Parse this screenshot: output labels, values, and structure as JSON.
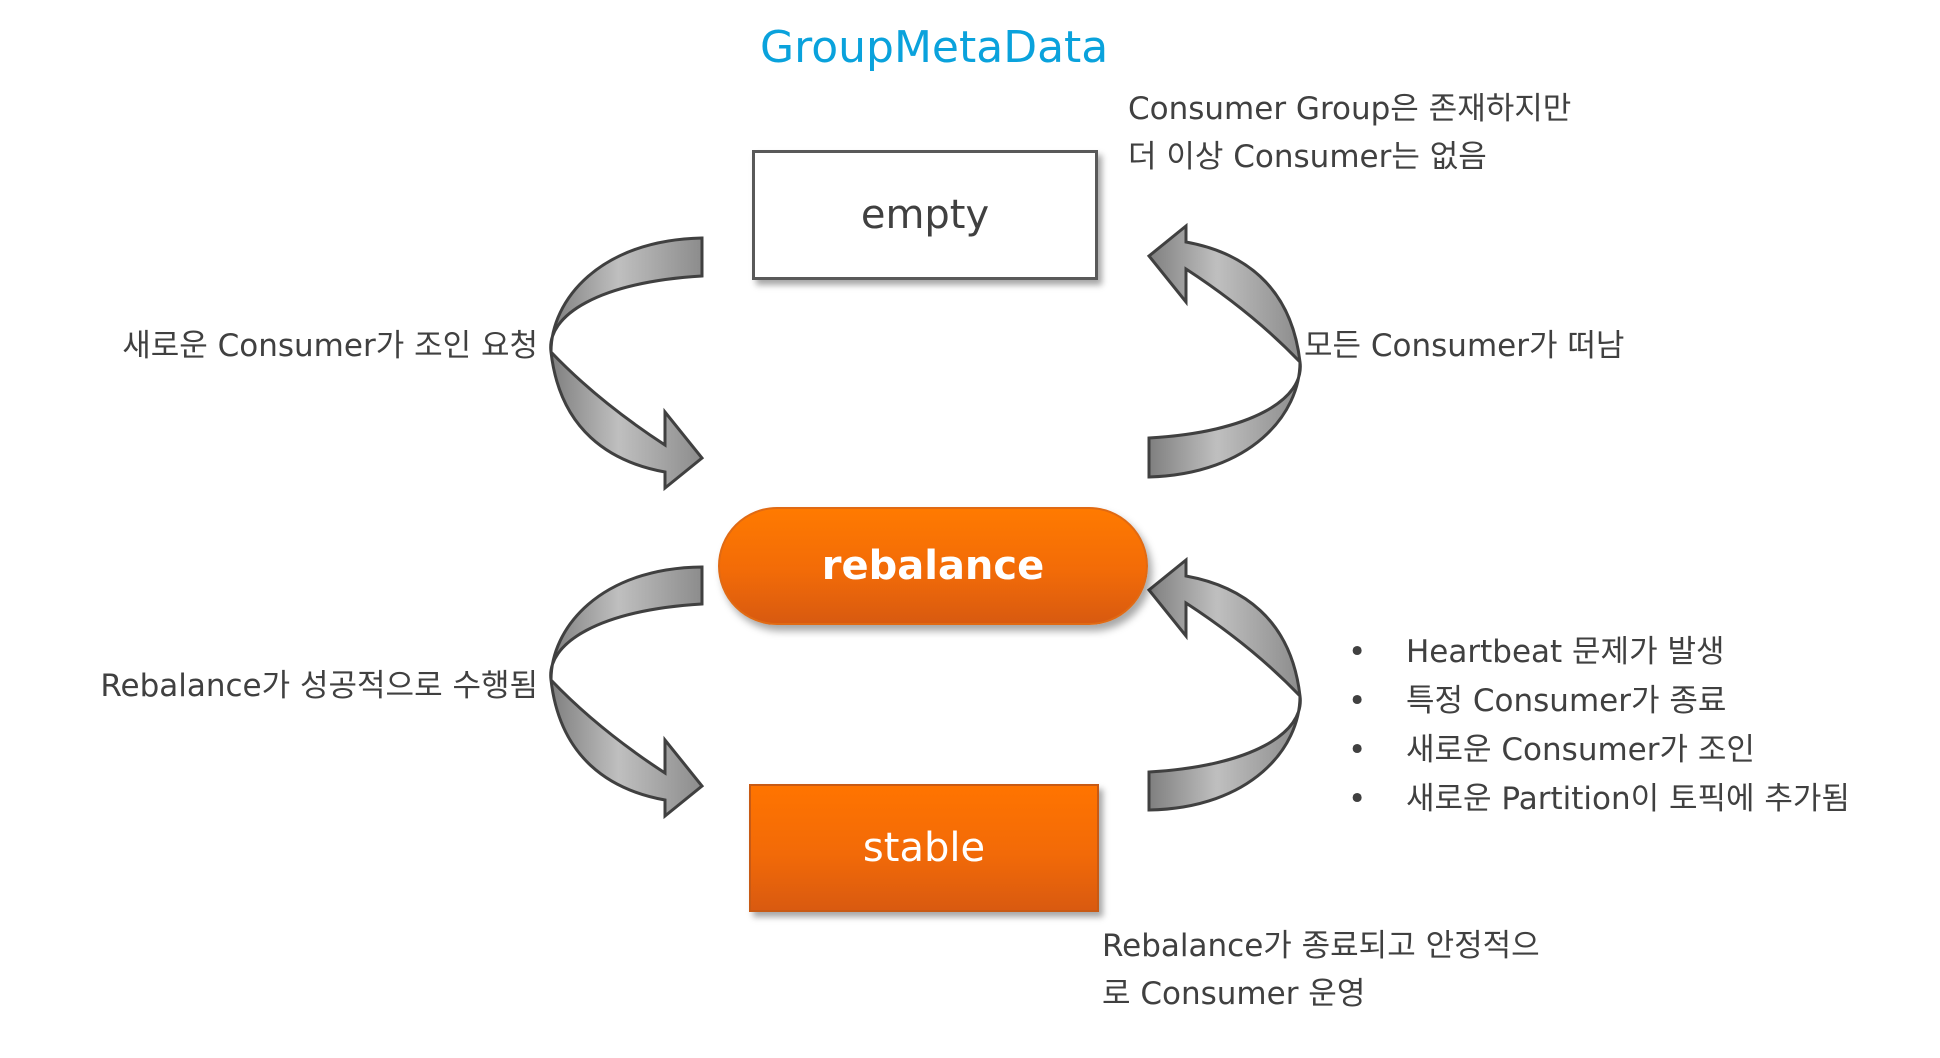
{
  "title": "GroupMetaData",
  "states": {
    "empty": "empty",
    "rebalance": "rebalance",
    "stable": "stable"
  },
  "descriptions": {
    "empty_line1": "Consumer Group은 존재하지만",
    "empty_line2": "더 이상 Consumer는 없음",
    "stable_line1": "Rebalance가 종료되고 안정적으",
    "stable_line2": "로 Consumer 운영"
  },
  "transitions": {
    "empty_to_rebalance": "새로운 Consumer가 조인 요청",
    "rebalance_to_empty": "모든 Consumer가 떠남",
    "rebalance_to_stable": "Rebalance가 성공적으로 수행됨",
    "stable_to_rebalance_triggers": [
      "Heartbeat 문제가 발생",
      "특정 Consumer가 종료",
      "새로운 Consumer가 조인",
      "새로운 Partition이 토픽에 추가됨"
    ],
    "bullet": "•"
  },
  "colors": {
    "title": "#0aa2dc",
    "accent_orange": "#ff7a00",
    "arrow_fill": "#a6a6a6",
    "arrow_dark": "#7f7f7f",
    "text": "#404040"
  }
}
